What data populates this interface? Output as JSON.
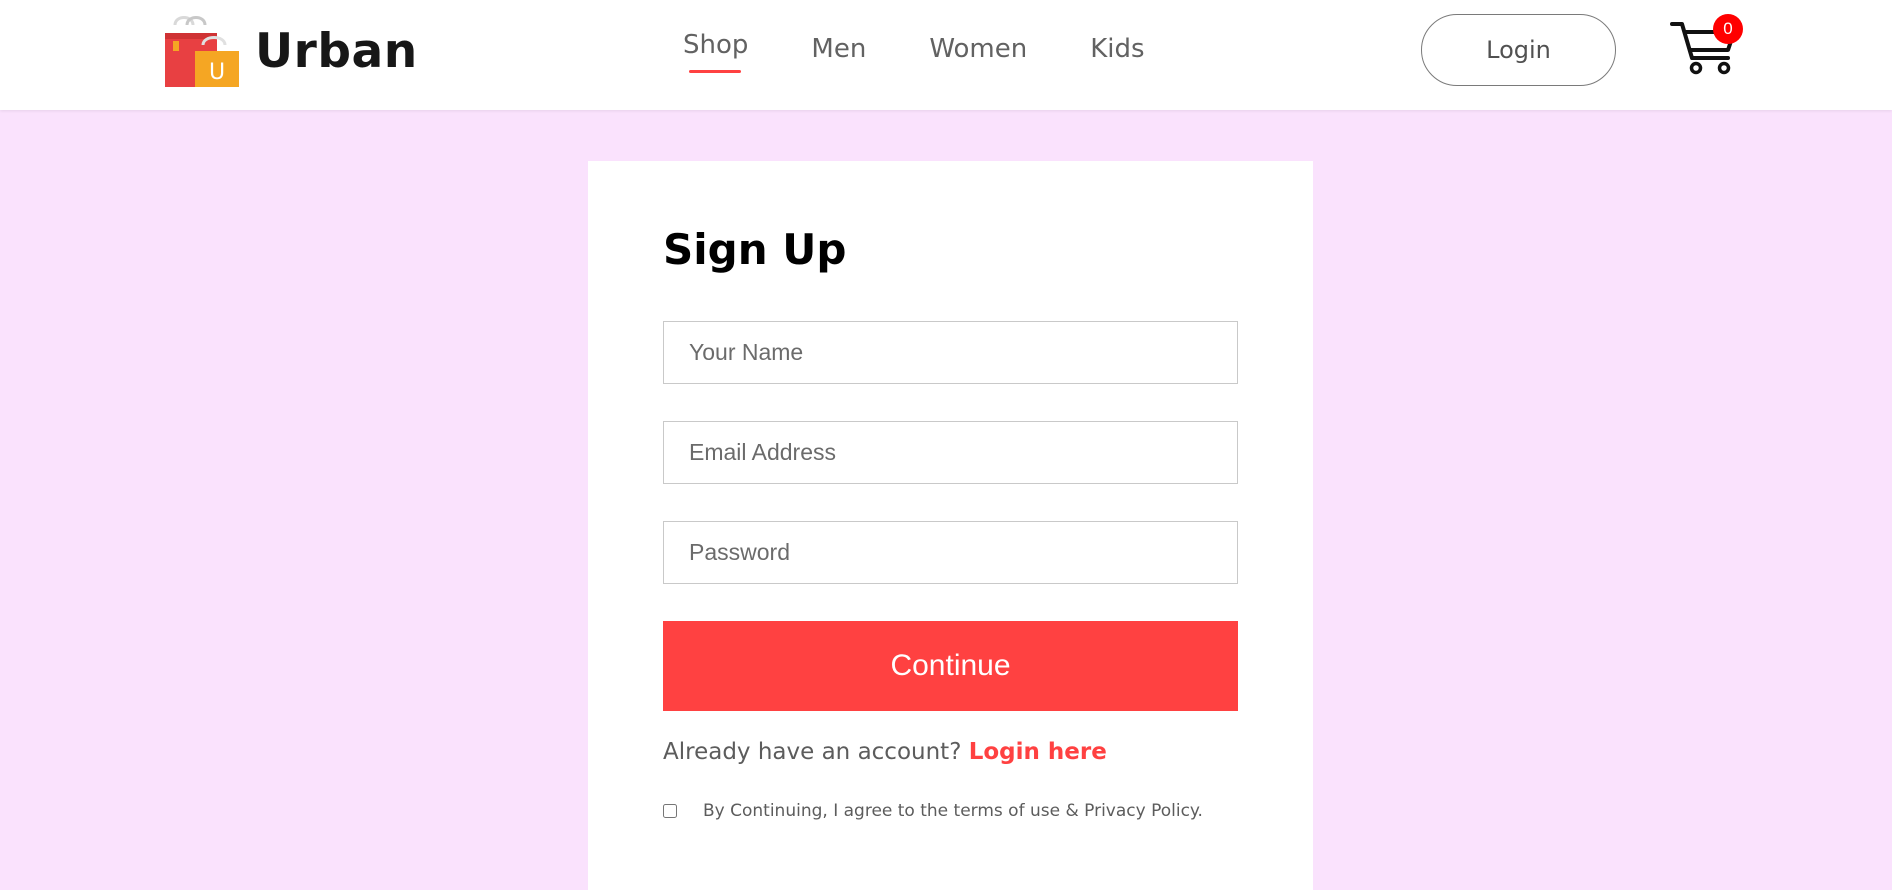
{
  "brand": {
    "name": "Urban",
    "logo_letter": "U"
  },
  "nav": {
    "items": [
      {
        "label": "Shop",
        "active": true
      },
      {
        "label": "Men"
      },
      {
        "label": "Women"
      },
      {
        "label": "Kids"
      }
    ]
  },
  "header": {
    "login_label": "Login",
    "cart_count": "0",
    "cart_icon": "shopping-cart-icon"
  },
  "form": {
    "title": "Sign Up",
    "name_placeholder": "Your Name",
    "email_placeholder": "Email Address",
    "password_placeholder": "Password",
    "continue_label": "Continue",
    "have_account_text": "Already have an account?",
    "login_link_label": "Login here",
    "agree_text": "By Continuing, I agree to the terms of use & Privacy Policy."
  },
  "colors": {
    "accent": "#ff4141",
    "page_background": "#fae2fd",
    "badge": "#ff0000"
  }
}
